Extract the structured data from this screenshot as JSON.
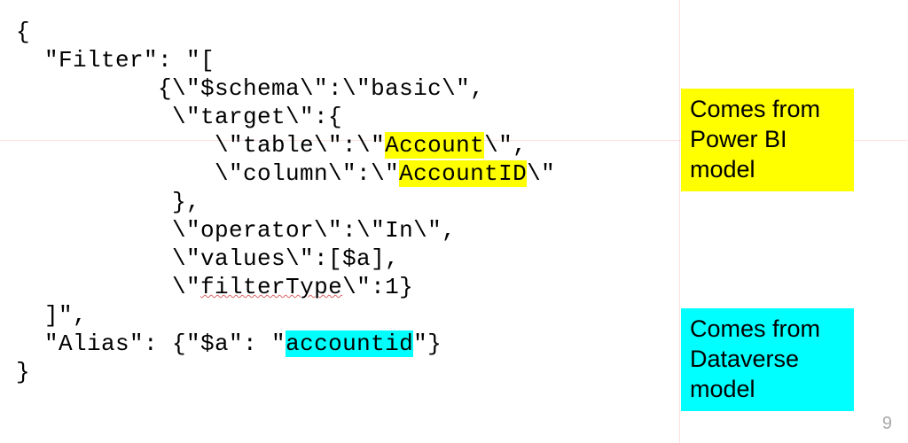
{
  "code": {
    "l1": "{",
    "l2": "  \"Filter\": \"[",
    "l3a": "          {\\\"$schema\\\":\\\"basic\\\",",
    "l4": "           \\\"target\\\":{",
    "l5a": "              \\\"table\\\":\\\"",
    "l5h": "Account",
    "l5b": "\\\",",
    "l6a": "              \\\"column\\\":\\\"",
    "l6h": "AccountID",
    "l6b": "\\\"",
    "l7": "           },",
    "l8": "           \\\"operator\\\":\\\"In\\\",",
    "l9": "           \\\"values\\\":[$a],",
    "l10a": "           \\\"",
    "l10w": "filterType",
    "l10b": "\\\":1}",
    "l11": "  ]\",",
    "l12a": "  \"Alias\": {\"$a\": \"",
    "l12h": "accountid",
    "l12b": "\"}",
    "l13": "}"
  },
  "annotations": {
    "powerbi": "Comes from Power BI model",
    "dataverse": "Comes from Dataverse model"
  },
  "page_number": "9"
}
